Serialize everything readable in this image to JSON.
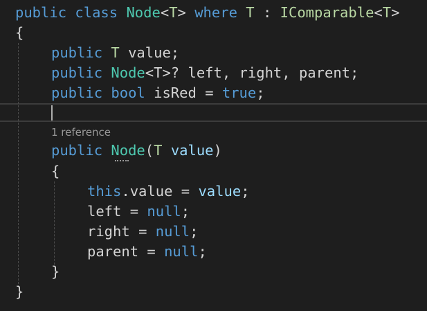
{
  "editor": {
    "language": "C#",
    "theme_colors": {
      "background": "#1e1e1e",
      "keyword": "#569cd6",
      "type": "#4ec9b0",
      "type_parameter": "#b8d7a3",
      "variable": "#9cdcfe",
      "text": "#d4d4d4",
      "codelens": "#999999"
    },
    "codelens": "1 reference",
    "lines": {
      "l1": {
        "public": "public",
        "class": "class",
        "name": "Node",
        "lt": "<",
        "tparam": "T",
        "gt": ">",
        "where": "where",
        "tparam2": "T",
        "colon": ":",
        "iface": "IComparable",
        "lt2": "<",
        "tparam3": "T",
        "gt2": ">"
      },
      "l2": "{",
      "l3": {
        "public": "public",
        "type": "T",
        "rest": "value;"
      },
      "l4": {
        "public": "public",
        "type": "Node",
        "generic": "<T>?",
        "rest": "left, right, parent;"
      },
      "l5": {
        "public": "public",
        "bool": "bool",
        "name": "isRed",
        "eq": "=",
        "val": "true",
        "semi": ";"
      },
      "l7": {
        "public": "public",
        "ctor": "Node",
        "open": "(",
        "type": "T",
        "param": "value",
        "close": ")"
      },
      "l8": "{",
      "l9": {
        "this": "this",
        "dot": ".",
        "field": "value",
        "eq": "=",
        "param": "value",
        "semi": ";"
      },
      "l10": {
        "field": "left",
        "eq": "=",
        "val": "null",
        "semi": ";"
      },
      "l11": {
        "field": "right",
        "eq": "=",
        "val": "null",
        "semi": ";"
      },
      "l12": {
        "field": "parent",
        "eq": "=",
        "val": "null",
        "semi": ";"
      },
      "l13": "}",
      "l14": "}"
    }
  }
}
